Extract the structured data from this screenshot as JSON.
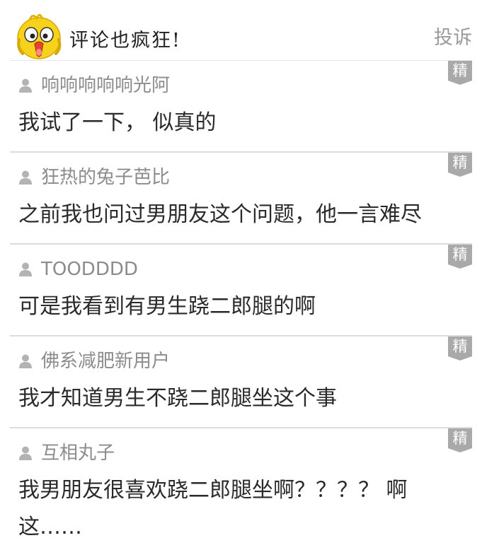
{
  "header": {
    "title": "评论也疯狂!",
    "report_label": "投诉",
    "mascot_icon": "yellow-bird-mascot-icon"
  },
  "badge_label": "精",
  "colors": {
    "username": "#8c8c8c",
    "comment_text": "#2a2a2a",
    "badge": "#a9a9a9",
    "divider": "#dcdcdc",
    "report_link": "#9a9a9a"
  },
  "comments": [
    {
      "user": "响响响响响光阿",
      "text": "我试了一下， 似真的"
    },
    {
      "user": "狂热的兔子芭比",
      "text": "之前我也问过男朋友这个问题，他一言难尽"
    },
    {
      "user": "TOODDDD",
      "text": "可是我看到有男生跷二郎腿的啊"
    },
    {
      "user": "佛系减肥新用户",
      "text": "我才知道男生不跷二郎腿坐这个事"
    },
    {
      "user": "互相丸子",
      "text": "我男朋友很喜欢跷二郎腿坐啊？？？？ 啊这……"
    }
  ]
}
